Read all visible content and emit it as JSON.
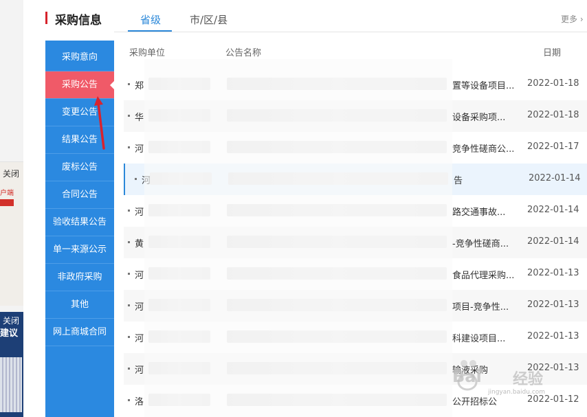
{
  "side_float": {
    "close_label": "关闭",
    "red_text": "户端",
    "qr_close_label": "关闭",
    "qr_text": "建议"
  },
  "header": {
    "title": "采购信息",
    "tabs": [
      {
        "label": "省级",
        "active": true
      },
      {
        "label": "市/区/县",
        "active": false
      }
    ],
    "more_label": "更多"
  },
  "sidebar": {
    "items": [
      {
        "label": "采购意向"
      },
      {
        "label": "采购公告",
        "active": true
      },
      {
        "label": "变更公告"
      },
      {
        "label": "结果公告"
      },
      {
        "label": "废标公告"
      },
      {
        "label": "合同公告"
      },
      {
        "label": "验收结果公告"
      },
      {
        "label": "单一来源公示"
      },
      {
        "label": "非政府采购"
      },
      {
        "label": "其他"
      },
      {
        "label": "网上商城合同"
      }
    ]
  },
  "table": {
    "columns": {
      "unit": "采购单位",
      "title": "公告名称",
      "date": "日期"
    },
    "rows": [
      {
        "unit": "郑",
        "title": "置等设备项目...",
        "date": "2022-01-18"
      },
      {
        "unit": "华",
        "title": "设备采购项...",
        "date": "2022-01-18"
      },
      {
        "unit": "河",
        "title": "竞争性磋商公...",
        "date": "2022-01-17"
      },
      {
        "unit": "河",
        "title": "告",
        "date": "2022-01-14"
      },
      {
        "unit": "河",
        "title": "路交通事故...",
        "date": "2022-01-14"
      },
      {
        "unit": "黄",
        "title": "-竞争性磋商...",
        "date": "2022-01-14"
      },
      {
        "unit": "河",
        "title": "食品代理采购...",
        "date": "2022-01-13"
      },
      {
        "unit": "河",
        "title": "项目-竞争性...",
        "date": "2022-01-13"
      },
      {
        "unit": "河",
        "title": "科建设项目...",
        "date": "2022-01-13"
      },
      {
        "unit": "河",
        "title": "输液采购",
        "date": "2022-01-13"
      },
      {
        "unit": "洛",
        "title": "公开招标公",
        "date": "2022-01-12"
      }
    ]
  },
  "watermark": {
    "brand": "Bai",
    "brand_cn": "经验",
    "url": "jingyan.baidu.com"
  },
  "colors": {
    "accent_blue": "#2b88d9",
    "sidebar_blue": "#2b89e0",
    "active_red": "#f05a68",
    "title_mark": "#d6232b"
  }
}
